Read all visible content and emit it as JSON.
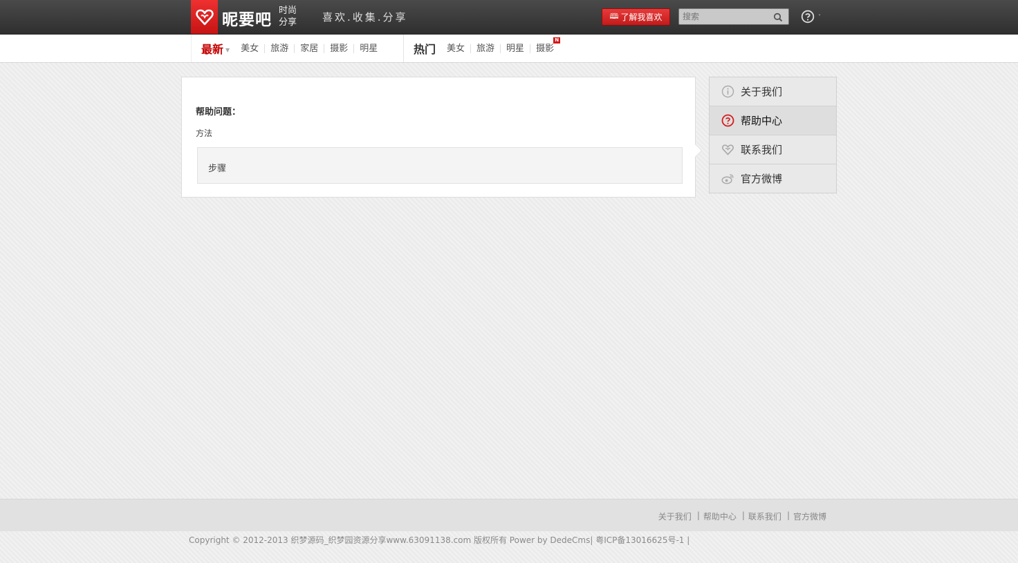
{
  "header": {
    "logo_name": "昵要吧",
    "logo_sub": "时尚分享",
    "slogan": "喜欢.收集.分享",
    "learn_button": "了解我喜欢",
    "search_placeholder": "搜索",
    "accent": "#d61c1c"
  },
  "nav": {
    "latest": {
      "label": "最新",
      "items": [
        "美女",
        "旅游",
        "家居",
        "摄影",
        "明星"
      ]
    },
    "hot": {
      "label": "热门",
      "items": [
        "美女",
        "旅游",
        "明星",
        "摄影"
      ],
      "badge": "N"
    }
  },
  "main": {
    "help_title": "帮助问题：",
    "method_label": "方法",
    "steps_label": "步骤"
  },
  "sidebar": {
    "items": [
      {
        "label": "关于我们",
        "icon": "info-icon"
      },
      {
        "label": "帮助中心",
        "icon": "question-icon",
        "active": true
      },
      {
        "label": "联系我们",
        "icon": "heart-icon"
      },
      {
        "label": "官方微博",
        "icon": "weibo-icon"
      }
    ]
  },
  "footer": {
    "links": [
      "关于我们",
      "帮助中心",
      "联系我们",
      "官方微博"
    ],
    "copyright": "Copyright © 2012-2013 织梦源码_织梦园资源分享www.63091138.com 版权所有 Power by DedeCms| 粤ICP备13016625号-1 |"
  }
}
